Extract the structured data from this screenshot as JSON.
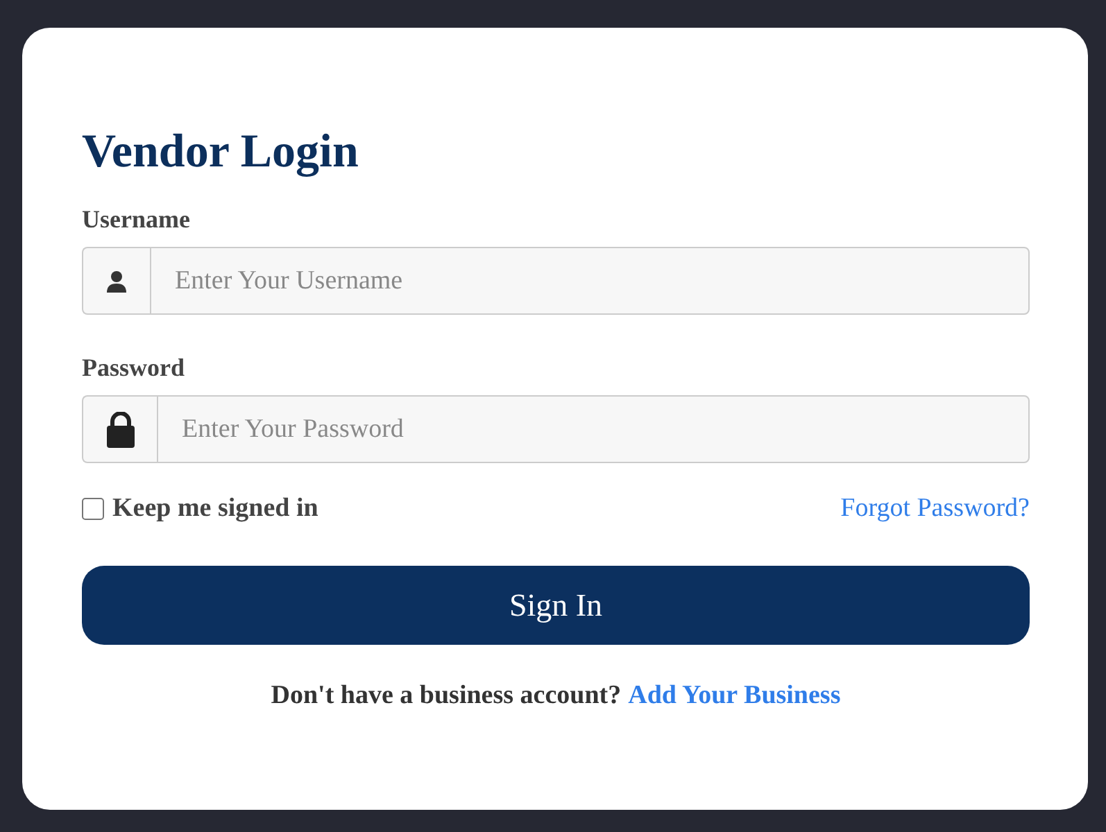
{
  "title": "Vendor Login",
  "fields": [
    {
      "label": "Username",
      "placeholder": "Enter Your Username",
      "kind": "user"
    },
    {
      "label": "Password",
      "placeholder": "Enter Your Password",
      "kind": "password"
    }
  ],
  "remember": {
    "label": "Keep me signed in",
    "checked": false
  },
  "forgot_link": "Forgot Password?",
  "submit": "Sign In",
  "footer": {
    "text": "Don't have a business account?",
    "link": "Add Your Business"
  }
}
